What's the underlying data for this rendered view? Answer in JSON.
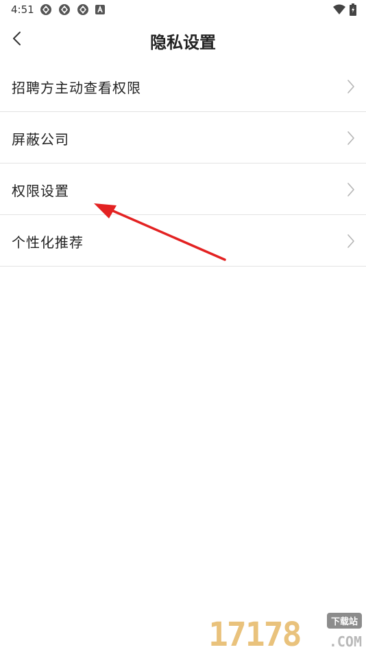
{
  "status_bar": {
    "time": "4:51",
    "notification_icons": [
      "shutter-icon",
      "shutter-icon",
      "shutter-icon",
      "a-badge-icon"
    ],
    "system_icons": [
      "wifi-icon",
      "battery-icon"
    ]
  },
  "header": {
    "back_icon": "chevron-left-icon",
    "title": "隐私设置"
  },
  "menu": {
    "items": [
      {
        "label": "招聘方主动查看权限"
      },
      {
        "label": "屏蔽公司"
      },
      {
        "label": "权限设置"
      },
      {
        "label": "个性化推荐"
      }
    ]
  },
  "annotation": {
    "color": "#e32222"
  },
  "watermark": {
    "digits": "17178",
    "tag": "下载站",
    "suffix": ".COM"
  },
  "colors": {
    "divider": "#e2e2e2",
    "text": "#222222",
    "chevron": "#b5b5b5",
    "accent_arrow": "#e32222"
  }
}
